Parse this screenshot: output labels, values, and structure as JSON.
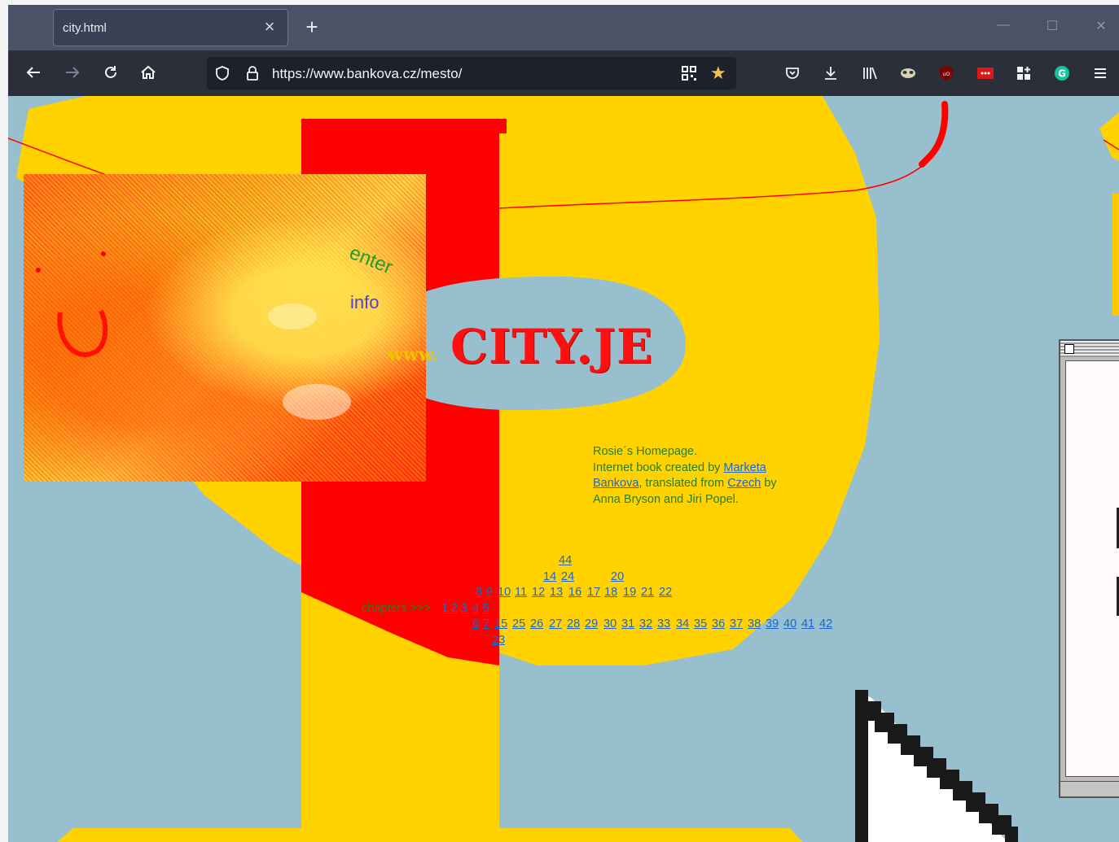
{
  "browser": {
    "tab": {
      "title": "city.html",
      "close_symbol": "×"
    },
    "new_tab_symbol": "+",
    "window_controls": {
      "minimize": "—",
      "maximize": "☐",
      "close": "✕"
    },
    "url": "https://www.bankova.cz/mesto/",
    "nav_icons": [
      "back-icon",
      "forward-icon",
      "reload-icon",
      "home-icon"
    ],
    "toolbar_icons": [
      "pocket-icon",
      "download-icon",
      "library-icon",
      "extension-mask-icon",
      "ublock-icon",
      "extension-dots-icon",
      "extension-grid-icon",
      "grammarly-icon",
      "menu-icon"
    ]
  },
  "page": {
    "logo": {
      "prefix": "www.",
      "name": "CITY.JE"
    },
    "links": {
      "enter": "enter",
      "info": "info"
    },
    "description": {
      "line1": "Rosie´s Homepage.",
      "text_a": "Internet book created by ",
      "link_marketa": "Marketa",
      "link_bankova": "Bankova",
      "text_b": ", translated from ",
      "link_czech": "Czech",
      "text_c": " by",
      "line4": "Anna Bryson and Jiri Popel."
    },
    "chapters_label": "chapters >>> ",
    "chapters": [
      "44",
      "14",
      "24",
      "20",
      "8",
      "9",
      "10",
      "11",
      "12",
      "13",
      "16",
      "17",
      "18",
      "19",
      "21",
      "22",
      "1",
      "2",
      "3",
      "4",
      "5",
      "6",
      "7",
      "15",
      "25",
      "26",
      "27",
      "28",
      "29",
      "30",
      "31",
      "32",
      "33",
      "34",
      "35",
      "36",
      "37",
      "38",
      "39",
      "40",
      "41",
      "42",
      "23"
    ],
    "colors": {
      "sky": "#97bfcd",
      "yellow": "#ffd200",
      "red": "#ff0000",
      "link": "#1a67cf",
      "green_text": "#238026"
    }
  }
}
